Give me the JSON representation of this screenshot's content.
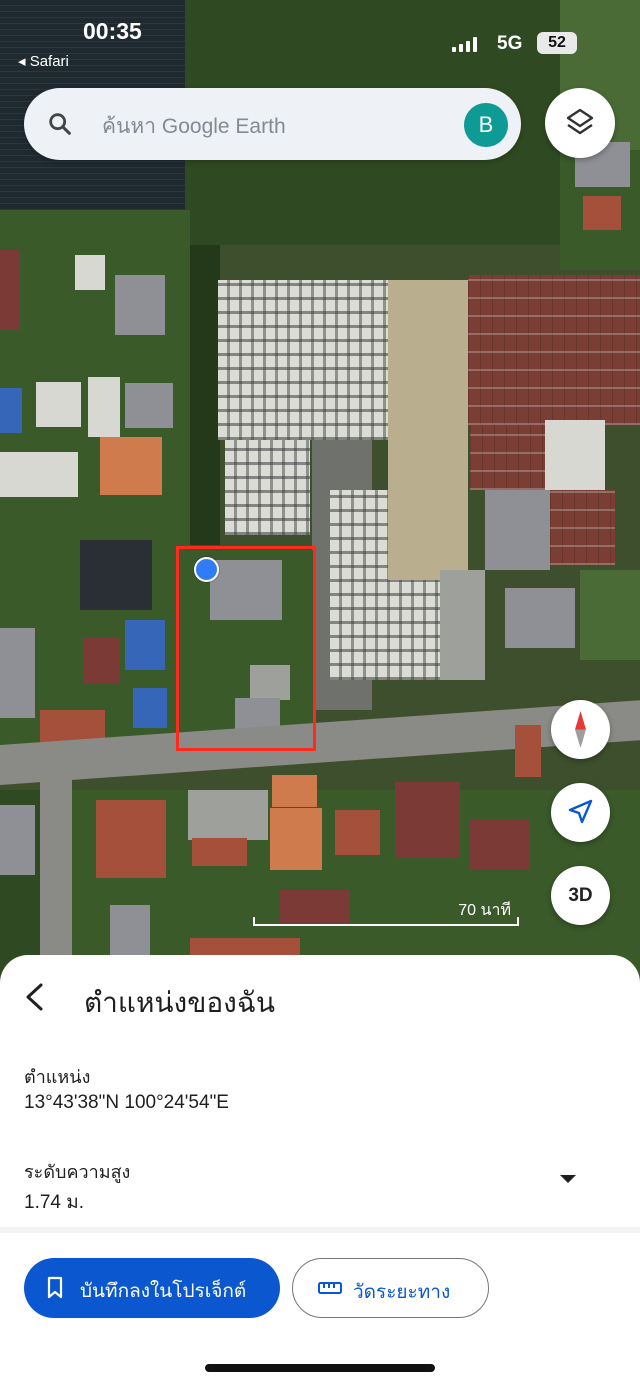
{
  "status_bar": {
    "time": "00:35",
    "back_app": "◂ Safari",
    "network": "5G",
    "battery": "52"
  },
  "search": {
    "placeholder": "ค้นหา Google Earth",
    "avatar_letter": "B"
  },
  "map_controls": {
    "three_d_label": "3D",
    "scale_label": "70 นาที"
  },
  "sheet": {
    "title": "ตำแหน่งของฉัน",
    "position_label": "ตำแหน่ง",
    "position_value": "13°43'38\"N 100°24'54\"E",
    "elevation_label": "ระดับความสูง",
    "elevation_value": "1.74 ม.",
    "save_button": "บันทึกลงในโปรเจ็กต์",
    "measure_button": "วัดระยะทาง"
  },
  "colors": {
    "accent": "#0b57d0",
    "avatar": "#0e9a95",
    "location_dot": "#2f7cf6",
    "parcel_outline": "#ff2a1e"
  },
  "icons": [
    "search-icon",
    "layers-icon",
    "compass-icon",
    "navigation-arrow-icon",
    "back-arrow-icon",
    "bookmark-icon",
    "ruler-icon",
    "chevron-down-icon"
  ]
}
